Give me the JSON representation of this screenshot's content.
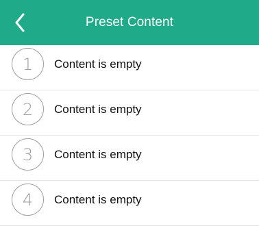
{
  "colors": {
    "nav_background": "#1fab89",
    "nav_text": "#ffffff",
    "circle_border": "#9e9e9e",
    "divider": "#e4e4e4"
  },
  "header": {
    "title": "Preset Content",
    "back_icon": "chevron-left-icon"
  },
  "presets": [
    {
      "number": "1",
      "label": "Content is empty"
    },
    {
      "number": "2",
      "label": "Content is empty"
    },
    {
      "number": "3",
      "label": "Content is empty"
    },
    {
      "number": "4",
      "label": "Content is empty"
    }
  ]
}
